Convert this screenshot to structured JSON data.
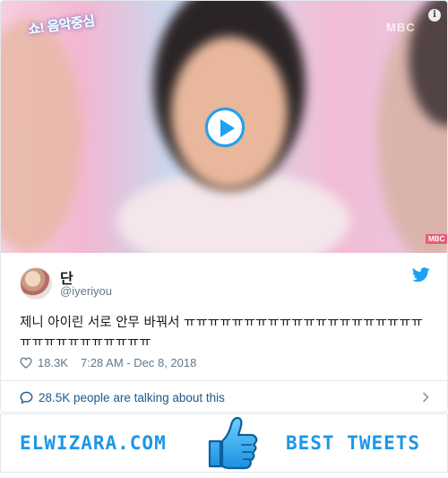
{
  "video": {
    "logo_text": "쇼! 음악중심",
    "channel": "MBC",
    "channel_small": "MBC",
    "info_label": "i"
  },
  "tweet": {
    "display_name": "단",
    "handle": "@iyeriyou",
    "text": "제니 아이린 서로 안무 바꿔서 ㅠㅠㅠㅠㅠㅠㅠㅠㅠㅠㅠㅠㅠㅠㅠㅠㅠㅠㅠㅠㅠㅠㅠㅠㅠㅠㅠㅠㅠㅠㅠ",
    "likes": "18.3K",
    "timestamp": "7:28 AM - Dec 8, 2018"
  },
  "talking": {
    "label": "28.5K people are talking about this"
  },
  "footer": {
    "site": "ELWIZARA.COM",
    "tagline": "BEST TWEETS"
  },
  "colors": {
    "twitter_blue": "#1da1f2",
    "footer_blue": "#1c97e8",
    "secondary_text": "#657786"
  }
}
